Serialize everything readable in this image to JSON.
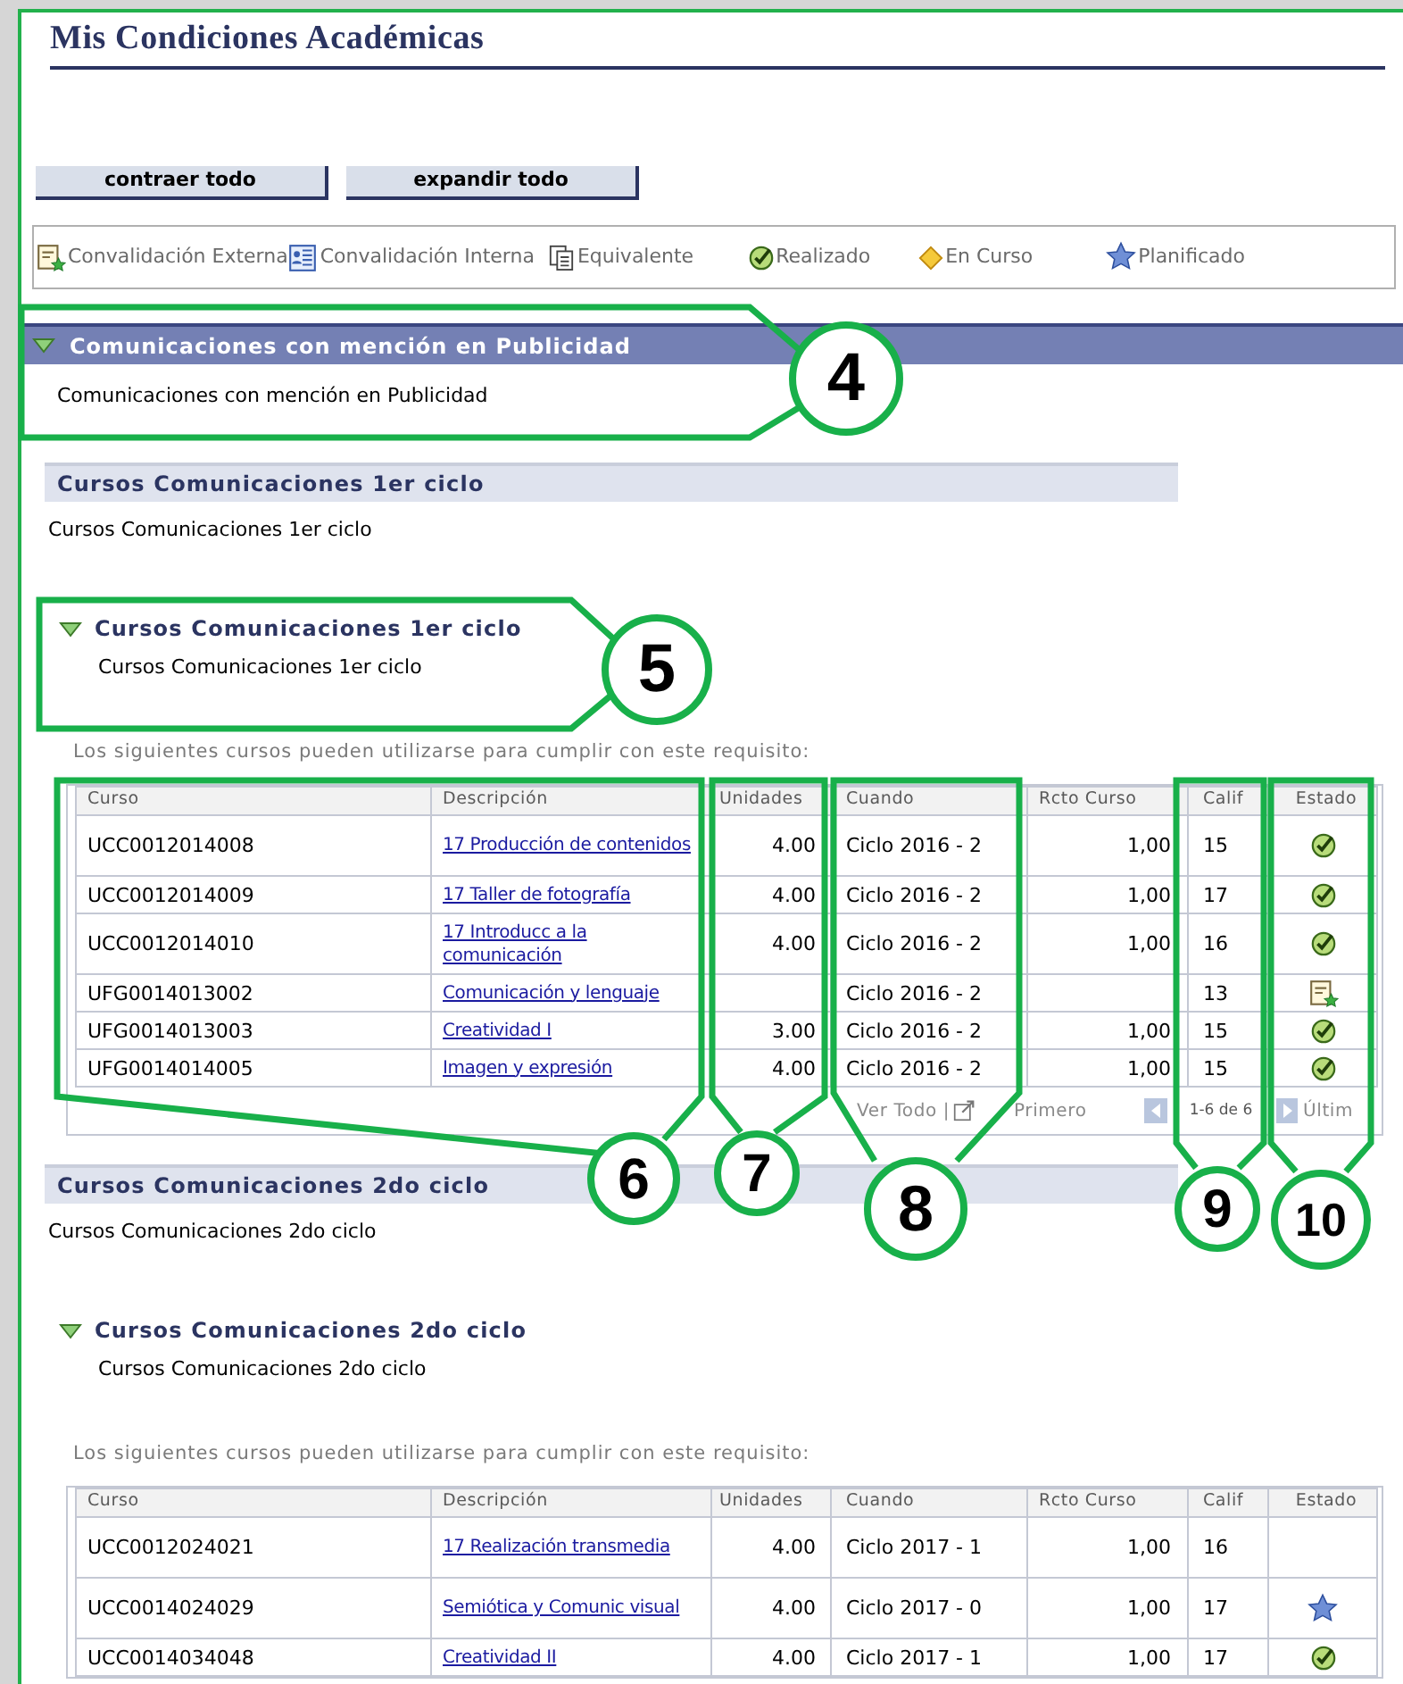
{
  "page": {
    "title": "Mis Condiciones Académicas",
    "buttons": [
      "contraer todo",
      "expandir todo"
    ]
  },
  "legend": [
    {
      "kind": "external",
      "label": "Convalidación Externa"
    },
    {
      "kind": "internal",
      "label": "Convalidación Interna"
    },
    {
      "kind": "equivalent",
      "label": "Equivalente"
    },
    {
      "kind": "done",
      "label": "Realizado"
    },
    {
      "kind": "in_progress",
      "label": "En Curso"
    },
    {
      "kind": "planned",
      "label": "Planificado"
    }
  ],
  "requirement": {
    "title": "Comunicaciones con mención en Publicidad",
    "expanded": true,
    "description": "Comunicaciones con mención en Publicidad"
  },
  "groups": [
    {
      "title": "Cursos Comunicaciones 1er ciclo",
      "description": "Cursos Comunicaciones 1er ciclo",
      "sub": {
        "title": "Cursos Comunicaciones 1er ciclo",
        "expanded": true,
        "description": "Cursos Comunicaciones 1er ciclo"
      },
      "caption": "Los siguientes cursos pueden utilizarse para cumplir con este requisito:",
      "columns": [
        "Curso",
        "Descripción",
        "Unidades",
        "Cuando",
        "Rcto Curso",
        "Calif",
        "Estado"
      ],
      "rows": [
        {
          "course": "UCC0012014008",
          "description": "17 Producción de contenidos",
          "units": "4.00",
          "when": "Ciclo 2016 - 2",
          "credit": "1,00",
          "grade": "15",
          "kind": "done"
        },
        {
          "course": "UCC0012014009",
          "description": "17 Taller de fotografía",
          "units": "4.00",
          "when": "Ciclo 2016 - 2",
          "credit": "1,00",
          "grade": "17",
          "kind": "done"
        },
        {
          "course": "UCC0012014010",
          "description": "17 Introducc a la comunicación",
          "units": "4.00",
          "when": "Ciclo 2016 - 2",
          "credit": "1,00",
          "grade": "16",
          "kind": "done"
        },
        {
          "course": "UFG0014013002",
          "description": "Comunicación y lenguaje",
          "when": "Ciclo 2016 - 2",
          "grade": "13",
          "kind": "external"
        },
        {
          "course": "UFG0014013003",
          "description": "Creatividad I",
          "units": "3.00",
          "when": "Ciclo 2016 - 2",
          "credit": "1,00",
          "grade": "15",
          "kind": "done"
        },
        {
          "course": "UFG0014014005",
          "description": "Imagen y expresión",
          "units": "4.00",
          "when": "Ciclo 2016 - 2",
          "credit": "1,00",
          "grade": "15",
          "kind": "done"
        }
      ],
      "pager": {
        "view_all": "Ver Todo |",
        "first": "Primero",
        "range": "1-6 de 6",
        "last": "Últim"
      }
    },
    {
      "title": "Cursos Comunicaciones 2do ciclo",
      "description": "Cursos Comunicaciones 2do ciclo",
      "sub": {
        "title": "Cursos Comunicaciones 2do ciclo",
        "expanded": true,
        "description": "Cursos Comunicaciones 2do ciclo"
      },
      "caption": "Los siguientes cursos pueden utilizarse para cumplir con este requisito:",
      "columns": [
        "Curso",
        "Descripción",
        "Unidades",
        "Cuando",
        "Rcto Curso",
        "Calif",
        "Estado"
      ],
      "rows": [
        {
          "course": "UCC0012024021",
          "description": "17 Realización transmedia",
          "units": "4.00",
          "when": "Ciclo 2017 - 1",
          "credit": "1,00",
          "grade": "16",
          "kind": "none"
        },
        {
          "course": "UCC0014024029",
          "description": "Semiótica y Comunic visual",
          "units": "4.00",
          "when": "Ciclo 2017 - 0",
          "credit": "1,00",
          "grade": "17",
          "kind": "planned"
        },
        {
          "course": "UCC0014034048",
          "description": "Creatividad II",
          "units": "4.00",
          "when": "Ciclo 2017 - 1",
          "credit": "1,00",
          "grade": "17",
          "kind": "done"
        }
      ]
    }
  ],
  "callouts": [
    {
      "number": "4"
    },
    {
      "number": "5"
    },
    {
      "number": "6"
    },
    {
      "number": "7"
    },
    {
      "number": "8"
    },
    {
      "number": "9"
    },
    {
      "number": "10"
    }
  ]
}
